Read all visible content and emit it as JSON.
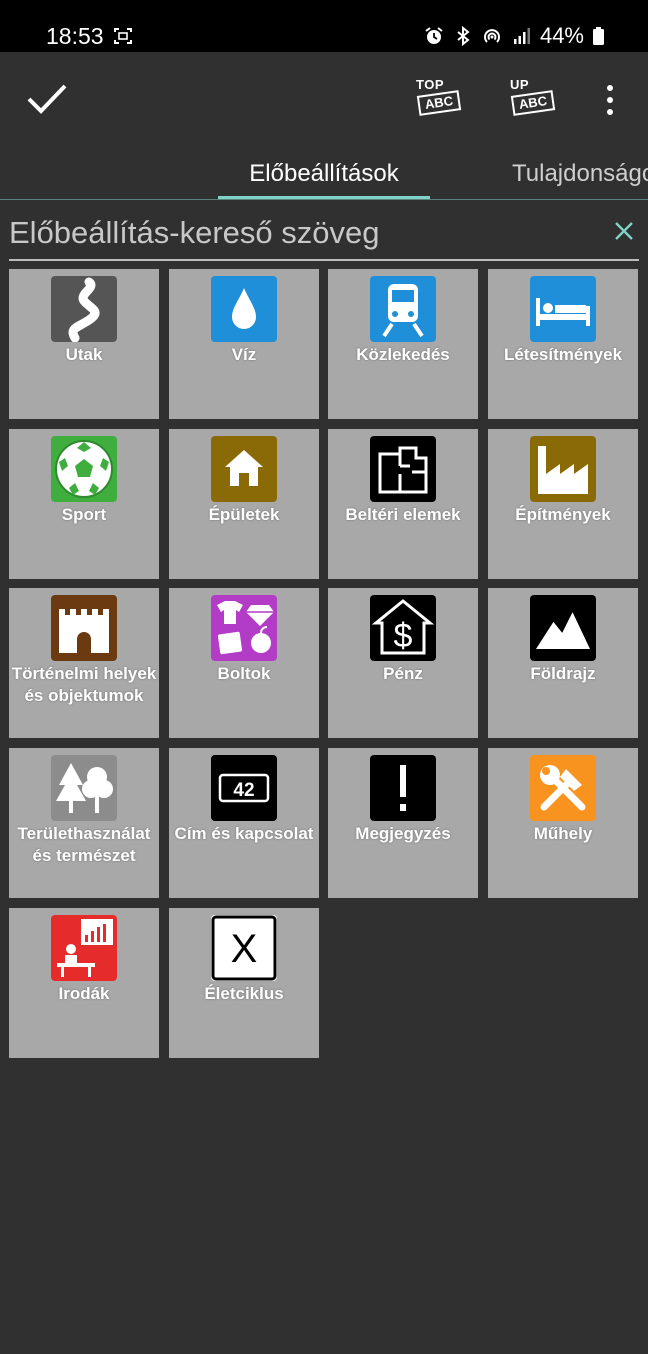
{
  "status_bar": {
    "time": "18:53",
    "battery": "44%",
    "icons": [
      "screenshot-icon",
      "alarm-icon",
      "bluetooth-icon",
      "hotspot-icon",
      "signal-icon",
      "battery-icon"
    ]
  },
  "toolbar": {
    "confirm_icon": "check-icon",
    "top_abc": {
      "tag": "TOP",
      "box": "ABC"
    },
    "up_abc": {
      "tag": "UP",
      "box": "ABC"
    },
    "menu_icon": "more-vert-icon"
  },
  "tabs": [
    {
      "label": "Előbeállítások",
      "active": true
    },
    {
      "label": "Tulajdonságok",
      "active": false
    }
  ],
  "search": {
    "placeholder": "Előbeállítás-kereső szöveg",
    "value": "",
    "clear_icon": "close-icon"
  },
  "presets": [
    {
      "label": "Utak",
      "icon": "road-icon",
      "color": "#555555"
    },
    {
      "label": "Víz",
      "icon": "water-drop-icon",
      "color": "#1e8fd8"
    },
    {
      "label": "Közlekedés",
      "icon": "train-icon",
      "color": "#1e8fd8"
    },
    {
      "label": "Létesítmények",
      "icon": "bed-icon",
      "color": "#1e8fd8"
    },
    {
      "label": "Sport",
      "icon": "soccer-ball-icon",
      "color": "#3fae3f"
    },
    {
      "label": "Épületek",
      "icon": "house-icon",
      "color": "#8a6a06"
    },
    {
      "label": "Beltéri elemek",
      "icon": "floorplan-icon",
      "color": "#000000"
    },
    {
      "label": "Építmények",
      "icon": "factory-icon",
      "color": "#8a6a06"
    },
    {
      "label": "Történelmi helyek és objektumok",
      "icon": "castle-icon",
      "color": "#6b3a10"
    },
    {
      "label": "Boltok",
      "icon": "shop-icon",
      "color": "#b23cc6"
    },
    {
      "label": "Pénz",
      "icon": "money-house-icon",
      "color": "#000000"
    },
    {
      "label": "Földrajz",
      "icon": "mountain-icon",
      "color": "#000000"
    },
    {
      "label": "Területhasználat és természet",
      "icon": "trees-icon",
      "color": "#8c8c8c"
    },
    {
      "label": "Cím és kapcsolat",
      "icon": "address-icon",
      "color": "#000000"
    },
    {
      "label": "Megjegyzés",
      "icon": "exclamation-icon",
      "color": "#000000"
    },
    {
      "label": "Műhely",
      "icon": "tools-icon",
      "color": "#f7931e"
    },
    {
      "label": "Irodák",
      "icon": "office-icon",
      "color": "#e62b2b"
    },
    {
      "label": "Életciklus",
      "icon": "lifecycle-x-icon",
      "color": "#ffffff"
    }
  ],
  "address_number": "42",
  "lifecycle_letter": "X",
  "money_symbol": "$"
}
